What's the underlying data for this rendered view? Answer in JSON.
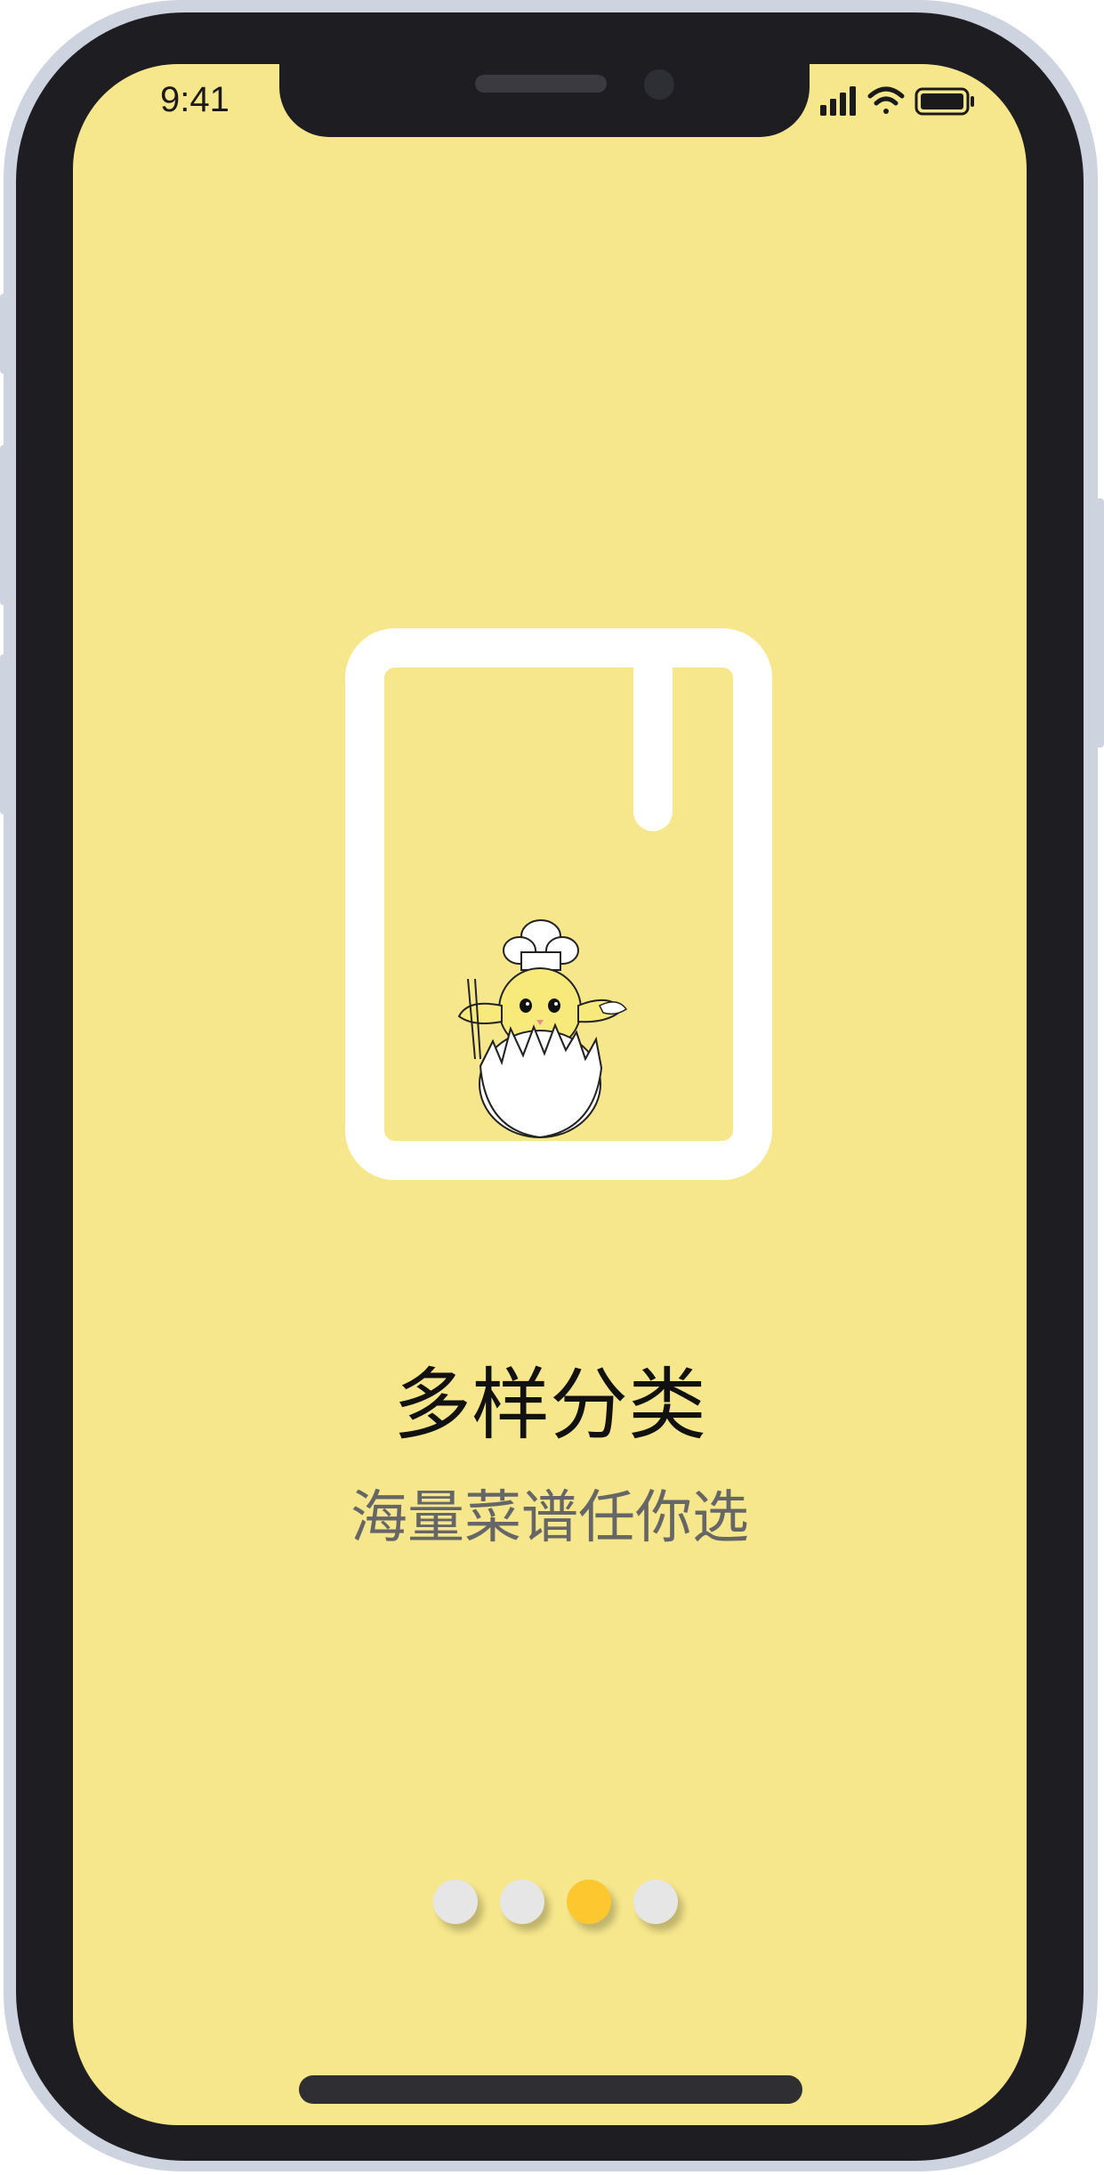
{
  "status_bar": {
    "time": "9:41",
    "icons": [
      "signal-icon",
      "wifi-icon",
      "battery-icon"
    ]
  },
  "onboarding": {
    "illustration": "recipe-book-icon",
    "mascot": "chef-chick-icon",
    "title": "多样分类",
    "subtitle": "海量菜谱任你选"
  },
  "pagination": {
    "total": 4,
    "active_index": 2,
    "active_color": "#fdc72f",
    "inactive_color": "#e6e6e6"
  },
  "colors": {
    "screen_background": "#f6e78c",
    "frame": "#1d1d22",
    "device_edge": "#cdd3df"
  }
}
